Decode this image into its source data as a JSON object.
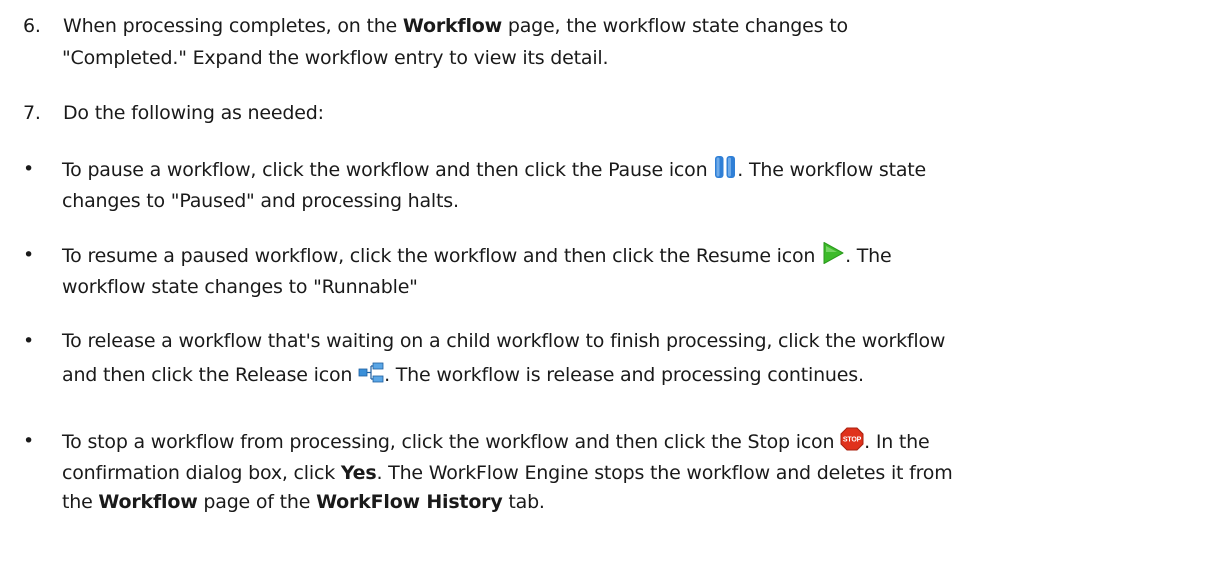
{
  "step6": {
    "number": "6.",
    "t1": "When processing completes, on the ",
    "b1": "Workflow",
    "t2": " page, the workflow state changes to",
    "line2": "\"Completed.\" Expand the workflow entry to view its detail."
  },
  "step7": {
    "number": "7.",
    "text": "Do the following as needed:"
  },
  "bullet_char": "•",
  "bullets": {
    "pause": {
      "t1": "To pause a workflow, click the workflow and then click the Pause icon ",
      "t2": ". The workflow state",
      "line2": "changes to \"Paused\" and processing halts.",
      "icon": "pause-icon"
    },
    "resume": {
      "t1": "To resume a paused workflow, click the workflow and then click the Resume icon ",
      "t2": ". The",
      "line2": "workflow state changes to \"Runnable\"",
      "icon": "resume-icon"
    },
    "release": {
      "line1": "To release a workflow that's waiting on a child workflow to finish processing, click the workflow",
      "t1": "and then click the Release icon ",
      "t2": ". The workflow is release and processing continues.",
      "icon": "release-icon"
    },
    "stop": {
      "t1": "To stop a workflow from processing, click the workflow and then click the Stop icon ",
      "t2": ". In the",
      "l2a": "confirmation dialog box, click ",
      "l2b": "Yes",
      "l2c": ". The WorkFlow Engine stops the workflow and deletes it from",
      "l3a": "the ",
      "l3b": "Workflow",
      "l3c": " page of the ",
      "l3d": "WorkFlow History",
      "l3e": " tab.",
      "icon": "stop-icon",
      "icon_label": "STOP"
    }
  },
  "colors": {
    "text": "#1a1a1a",
    "pause_blue": "#2f7fd6",
    "resume_green": "#3dbb2a",
    "release_blue": "#3a8fd8",
    "stop_red": "#e0321c"
  }
}
